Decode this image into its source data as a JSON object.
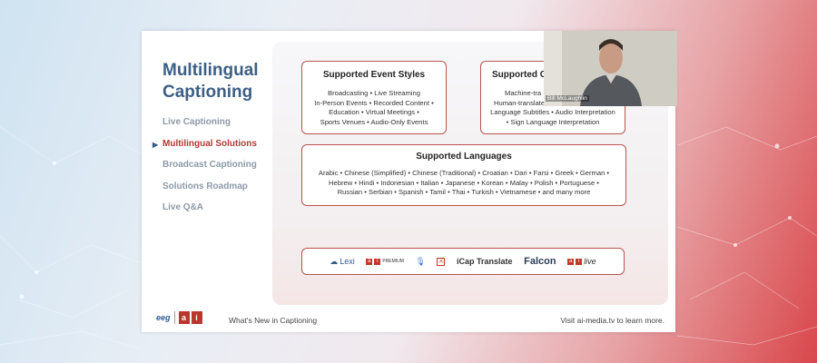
{
  "slide": {
    "title": "Multilingual Captioning",
    "nav": [
      {
        "label": "Live Captioning",
        "active": false
      },
      {
        "label": "Multilingual Solutions",
        "active": true
      },
      {
        "label": "Broadcast Captioning",
        "active": false
      },
      {
        "label": "Solutions Roadmap",
        "active": false
      },
      {
        "label": "Live Q&A",
        "active": false
      }
    ],
    "boxes": {
      "event_styles": {
        "title": "Supported Event Styles",
        "lines": [
          "Broadcasting • Live Streaming",
          "In-Person Events • Recorded Content •",
          "Education • Virtual Meetings •",
          "Sports Venues • Audio-Only Events"
        ]
      },
      "caption_types": {
        "title": "Supported Ca",
        "lines": [
          "Machine-tra",
          "Human-translate",
          "Language Subtitles • Audio Interpretation",
          "• Sign Language Interpretation"
        ]
      },
      "languages": {
        "title": "Supported Languages",
        "lines": [
          "Arabic • Chinese (Simplified) • Chinese (Traditional) • Croatian • Dari • Farsi • Greek • German •",
          "Hebrew • Hindi • Indonesian • Italian • Japanese • Korean • Malay • Polish • Portuguese •",
          "Russian • Serbian • Spanish • Tamil • Thai • Turkish • Vietnamese • and many more"
        ]
      }
    },
    "product_logos": [
      {
        "label": "Lexi",
        "icon": "lexi-cloud-icon"
      },
      {
        "label": "PREMIUM",
        "icon": "ai-premium-icon"
      },
      {
        "label": "",
        "icon": "microphone-icon"
      },
      {
        "label": "",
        "icon": "translate-icon"
      },
      {
        "label": "iCap Translate",
        "icon": "icap-icon"
      },
      {
        "label": "Falcon",
        "icon": "falcon-icon"
      },
      {
        "label": "live",
        "icon": "ai-live-icon"
      }
    ],
    "footer": {
      "brand_eeg": "eeg",
      "brand_ai": [
        "a",
        "i"
      ],
      "center_text": "What's New in Captioning",
      "right_text": "Visit ai-media.tv to learn more."
    }
  },
  "video": {
    "speaker_name": "Bill McLaughlin"
  },
  "colors": {
    "title_blue": "#3d5f85",
    "accent_red": "#b13a33",
    "box_border": "#b9534c"
  }
}
